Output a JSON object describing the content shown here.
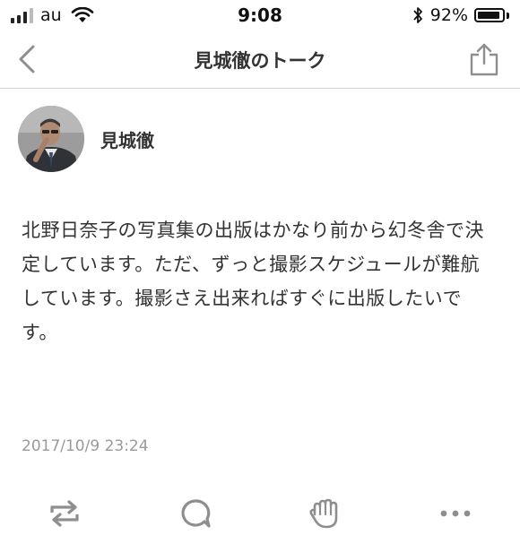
{
  "status_bar": {
    "carrier": "au",
    "time": "9:08",
    "battery_percent": "92%",
    "battery_level": 0.92,
    "icons": [
      "signal-icon",
      "wifi-icon",
      "bluetooth-icon",
      "battery-icon"
    ]
  },
  "nav": {
    "title": "見城徹のトーク",
    "back_icon": "chevron-left-icon",
    "share_icon": "share-icon"
  },
  "post": {
    "author": "見城徹",
    "text": "北野日奈子の写真集の出版はかなり前から幻冬舎で決定しています。ただ、ずっと撮影スケジュールが難航しています。撮影さえ出来ればすぐに出版したいです。",
    "timestamp": "2017/10/9 23:24"
  },
  "actions": [
    "repost-icon",
    "comment-icon",
    "applause-icon",
    "more-icon"
  ],
  "colors": {
    "text": "#333333",
    "icon": "#8e8e8e",
    "timestamp": "#9a9a9a",
    "divider": "#d6d6d6"
  }
}
